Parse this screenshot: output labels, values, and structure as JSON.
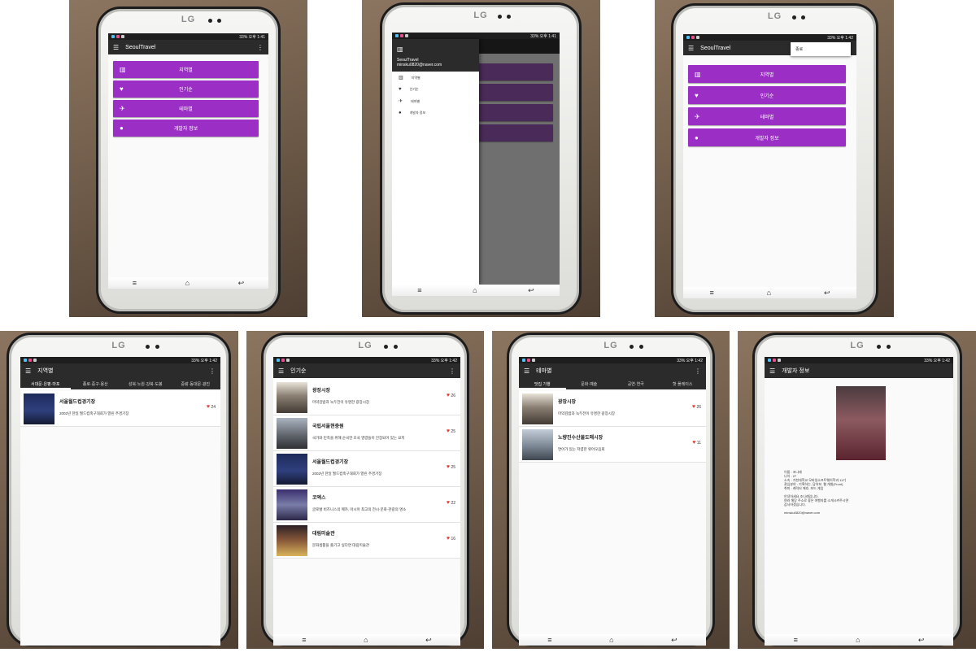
{
  "status": {
    "battery": "33%",
    "time_1": "오후 1:41",
    "time_2": "오후 1:42"
  },
  "brand": {
    "phone_logo": "LG"
  },
  "colors": {
    "accent": "#9b2fc5",
    "appbar": "#2b2b2b",
    "heart": "#e53935"
  },
  "main": {
    "app_title": "SeoulTravel",
    "buttons": [
      {
        "label": "지역별",
        "icon": "map-icon"
      },
      {
        "label": "인기순",
        "icon": "heart-icon"
      },
      {
        "label": "테마별",
        "icon": "airplane-icon"
      },
      {
        "label": "개발자 정보",
        "icon": "person-icon"
      }
    ]
  },
  "drawer": {
    "app_name": "SeoulTravel",
    "email": "minsku0820@naver.com",
    "items": [
      "지역별",
      "인기순",
      "테마별",
      "개발자 정보"
    ]
  },
  "overflow_menu": {
    "item": "종료"
  },
  "region": {
    "title": "지역별",
    "tabs": [
      "서대문·은평·마포",
      "종로·중구·용산",
      "성북·노원·강북·도봉",
      "중랑·동대문·광진"
    ],
    "items": [
      {
        "name": "서울월드컵경기장",
        "desc": "2002년 한일 월드컵축구대회가 열린 주경기장",
        "likes": "24"
      }
    ]
  },
  "popular": {
    "title": "인기순",
    "items": [
      {
        "name": "광장시장",
        "desc": "마약김밥과 녹두전이 유명한 광장시장",
        "likes": "26"
      },
      {
        "name": "국립서울현충원",
        "desc": "국가와 민족을 위해 순국한 호국 영령들이 안장되어 있는 묘지",
        "likes": "25"
      },
      {
        "name": "서울월드컵경기장",
        "desc": "2002년 한일 월드컵축구대회가 열린 주경기장",
        "likes": "25"
      },
      {
        "name": "코엑스",
        "desc": "글로벌 비즈니스의 메카, 아시아 최고의 전시·문화·관광의 명소",
        "likes": "22"
      },
      {
        "name": "대림미술관",
        "desc": "문화생활을 즐기고 싶다면 대림미술관",
        "likes": "16"
      }
    ]
  },
  "theme": {
    "title": "테마별",
    "tabs": [
      "맛집 기행",
      "문화·예술",
      "공연·연극",
      "핫 플레이스"
    ],
    "items": [
      {
        "name": "광장시장",
        "desc": "마약김밥과 녹두전이 유명한 광장시장",
        "likes": "26"
      },
      {
        "name": "노량진수산물도매시장",
        "desc": "연어가 있는 저렴한 횟어모음회",
        "likes": "11"
      }
    ]
  },
  "developer": {
    "title": "개발자 정보",
    "lines": [
      "이름 : 조나래",
      "나이 : 27",
      "소속 : 가천대학교 모바일소프트웨어학과 11기",
      "관심분야 : 기획하는, 답아보, 웹 개발(Front)",
      "취미 : 캐릭터 애호, 보드 게임",
      "",
      "안녕하세요 조나래입니다.",
      "여러 해당 주소로 좋은 여행지를 소개시켜주시면",
      "감사하겠습니다.",
      "",
      "minsku0820@naver.com"
    ]
  }
}
